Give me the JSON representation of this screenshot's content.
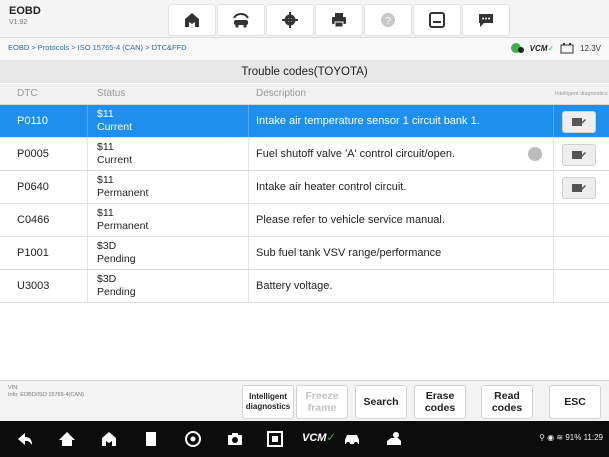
{
  "app": {
    "title": "EOBD",
    "version": "V1.92"
  },
  "toolbar": {
    "buttons": [
      {
        "icon": "home-icon"
      },
      {
        "icon": "vehicle-swap-icon"
      },
      {
        "icon": "gear-icon"
      },
      {
        "icon": "printer-icon"
      },
      {
        "icon": "help-icon"
      },
      {
        "icon": "save-icon"
      },
      {
        "icon": "chat-icon"
      }
    ]
  },
  "breadcrumb": "EOBD > Protocols > ISO 15765-4 (CAN) > DTC&FFD",
  "vci": {
    "label": "VCM",
    "voltage": "12.3V"
  },
  "table": {
    "title": "Trouble codes(TOYOTA)",
    "columns": {
      "dtc": "DTC",
      "status": "Status",
      "description": "Description",
      "intelligent": "Intelligent diagnostics"
    },
    "rows": [
      {
        "dtc": "P0110",
        "status_code": "$11",
        "status_text": "Current",
        "description": "Intake air temperature sensor 1 circuit bank 1.",
        "selected": true,
        "freeze_frame": false,
        "intelligent": true
      },
      {
        "dtc": "P0005",
        "status_code": "$11",
        "status_text": "Current",
        "description": "Fuel shutoff valve 'A' control circuit/open.",
        "selected": false,
        "freeze_frame": true,
        "intelligent": true
      },
      {
        "dtc": "P0640",
        "status_code": "$11",
        "status_text": "Permanent",
        "description": "Intake air heater control circuit.",
        "selected": false,
        "freeze_frame": false,
        "intelligent": true
      },
      {
        "dtc": "C0466",
        "status_code": "$11",
        "status_text": "Permanent",
        "description": "Please refer to vehicle service manual.",
        "selected": false,
        "freeze_frame": false,
        "intelligent": false
      },
      {
        "dtc": "P1001",
        "status_code": "$3D",
        "status_text": "Pending",
        "description": "Sub fuel tank VSV range/performance",
        "selected": false,
        "freeze_frame": false,
        "intelligent": false
      },
      {
        "dtc": "U3003",
        "status_code": "$3D",
        "status_text": "Pending",
        "description": "Battery voltage.",
        "selected": false,
        "freeze_frame": false,
        "intelligent": false
      }
    ]
  },
  "footer": {
    "vin_label": "VIN:",
    "info": "Info: EOBD/ISO 15765-4(CAN)",
    "buttons": {
      "intelligent": {
        "line1": "Intelligent",
        "line2": "diagnostics",
        "enabled": true
      },
      "freeze": {
        "line1": "Freeze",
        "line2": "frame",
        "enabled": false
      },
      "search": {
        "label": "Search",
        "enabled": true
      },
      "erase": {
        "line1": "Erase",
        "line2": "codes",
        "enabled": true
      },
      "read": {
        "line1": "Read",
        "line2": "codes",
        "enabled": true
      },
      "esc": {
        "label": "ESC",
        "enabled": true
      }
    }
  },
  "navbar": {
    "status_text": "91%",
    "time": "11:29",
    "vcm_label": "VCM"
  },
  "colors": {
    "accent": "#1e8fec",
    "vcm_green": "#3cb34a"
  }
}
